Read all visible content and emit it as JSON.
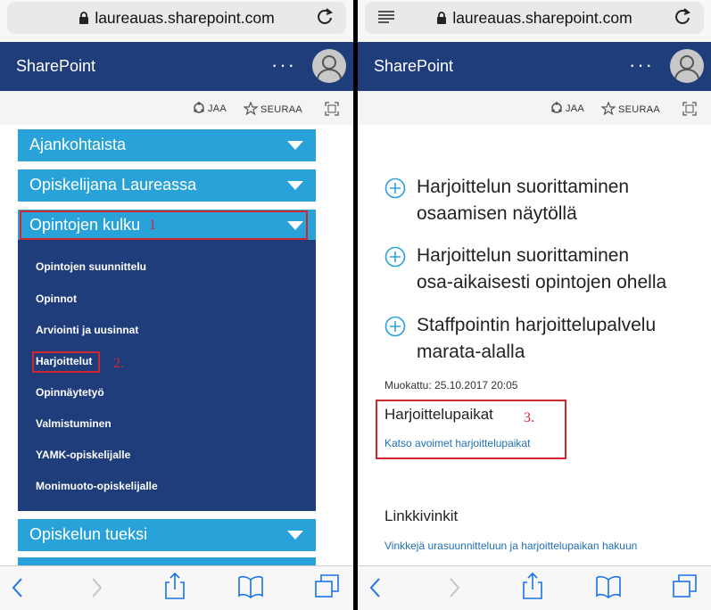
{
  "browser": {
    "url": "laureauas.sharepoint.com"
  },
  "sharepoint": {
    "title": "SharePoint",
    "more": "···"
  },
  "actions": {
    "share": "JAA",
    "follow": "SEURAA"
  },
  "left": {
    "nav_top": [
      {
        "label": "Ajankohtaista"
      },
      {
        "label": "Opiskelijana Laureassa"
      },
      {
        "label": "Opintojen kulku"
      }
    ],
    "nav_bottom": [
      {
        "label": "Opiskelun tueksi"
      }
    ],
    "sub_items": [
      {
        "label": "Opintojen suunnittelu"
      },
      {
        "label": "Opinnot"
      },
      {
        "label": "Arviointi ja uusinnat"
      },
      {
        "label": "Harjoittelut"
      },
      {
        "label": "Opinnäytetyö"
      },
      {
        "label": "Valmistuminen"
      },
      {
        "label": "YAMK-opiskelijalle"
      },
      {
        "label": "Monimuoto-opiskelijalle"
      }
    ],
    "annotation_1": "1",
    "annotation_2": "2."
  },
  "right": {
    "items": [
      {
        "line1": "Harjoittelun suorittaminen",
        "line2": "osaamisen näytöllä"
      },
      {
        "line1": "Harjoittelun suorittaminen",
        "line2": "osa-aikaisesti opintojen ohella"
      },
      {
        "line1": "Staffpointin harjoittelupalvelu",
        "line2": "marata-alalla"
      }
    ],
    "modified": "Muokattu: 25.10.2017 20:05",
    "placements_heading": "Harjoittelupaikat",
    "placements_link": "Katso avoimet harjoittelupaikat",
    "annotation_3": "3.",
    "tips_heading": "Linkkivinkit",
    "tips_link": "Vinkkejä urasuunnitteluun ja harjoittelupaikan hakuun"
  },
  "colors": {
    "sharepoint_bar": "#1f3d7a",
    "nav_button": "#29a2da",
    "highlight": "#d0282f",
    "link": "#1f6fb5"
  }
}
